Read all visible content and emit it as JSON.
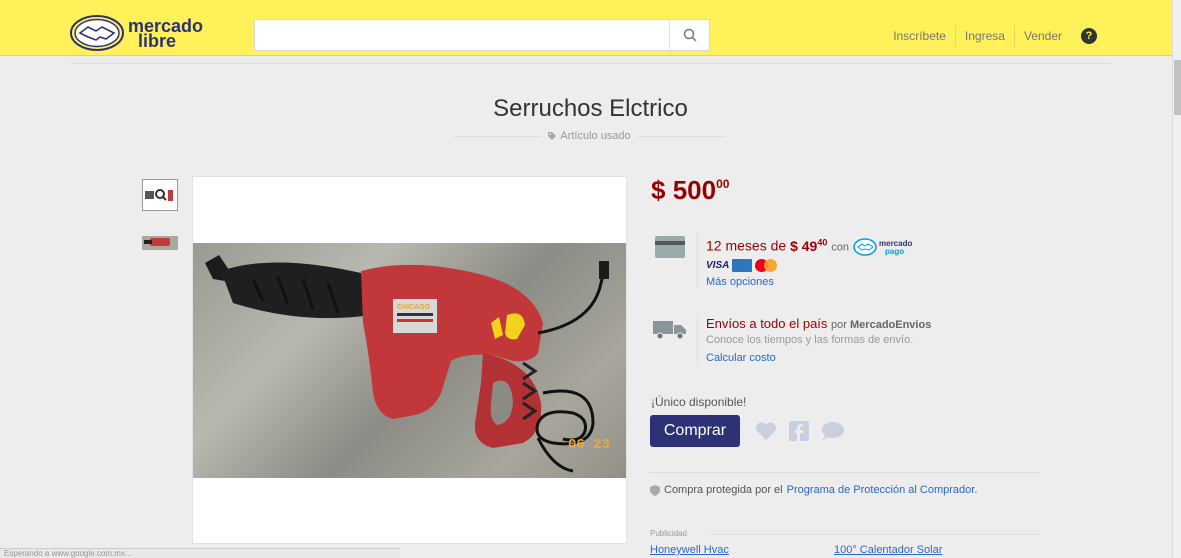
{
  "header": {
    "logo_line1": "mercado",
    "logo_line2": "libre",
    "search_placeholder": "",
    "nav": [
      "Inscríbete",
      "Ingresa",
      "Vender"
    ],
    "help_icon": "question-circle-icon"
  },
  "product": {
    "title": "Serruchos Elctrico",
    "condition": "Artículo usado",
    "price_currency": "$",
    "price_int": "500",
    "price_cents": "00",
    "photo_date": "06 23"
  },
  "payment": {
    "installments": "12 meses de",
    "installment_currency": "$",
    "installment_int": "49",
    "installment_cents": "40",
    "con": "con",
    "mp_line1": "mercado",
    "mp_line2": "pago",
    "visa": "VISA",
    "more_options": "Más opciones"
  },
  "shipping": {
    "title": "Envíos a todo el país",
    "by": "por",
    "by_brand": "MercadoEnvios",
    "subtitle": "Conoce los tiempos y las formas de envío.",
    "calc": "Calcular costo"
  },
  "purchase": {
    "availability": "¡Único disponible!",
    "buy_label": "Comprar"
  },
  "protection": {
    "prefix": "Compra protegida por el",
    "link": "Programa de Protección al Comprador",
    "suffix": "."
  },
  "ads": {
    "label": "Publicidad",
    "items": [
      "Honeywell Hvac",
      "100° Calentador Solar"
    ]
  },
  "status_bar": "Esperando a www.google.com.mx...",
  "colors": {
    "header_bg": "#fff159",
    "price": "#990000",
    "buy_button": "#2d3277",
    "link": "#2968c8"
  }
}
